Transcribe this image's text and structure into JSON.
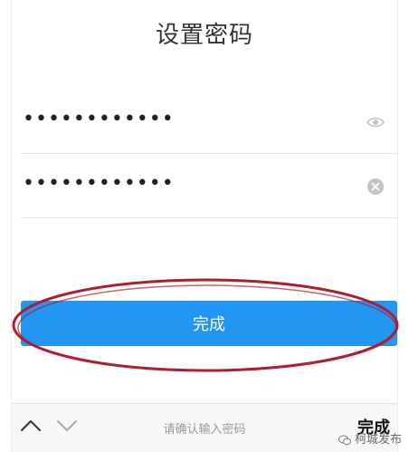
{
  "screen": {
    "title": "设置密码"
  },
  "form": {
    "password_value": "••••••••••••",
    "confirm_value": "••••••••••••"
  },
  "actions": {
    "done_label": "完成"
  },
  "keyboard_bar": {
    "hint": "请确认输入密码",
    "done_label": "完成"
  },
  "watermark": {
    "text": "柯城发布"
  },
  "colors": {
    "accent": "#2196f3",
    "annotation": "#b01e2e"
  },
  "icons": {
    "show_password": "eye-icon",
    "clear_field": "clear-icon",
    "prev_field": "chevron-up-icon",
    "next_field": "chevron-down-icon",
    "watermark": "wechat-icon"
  }
}
